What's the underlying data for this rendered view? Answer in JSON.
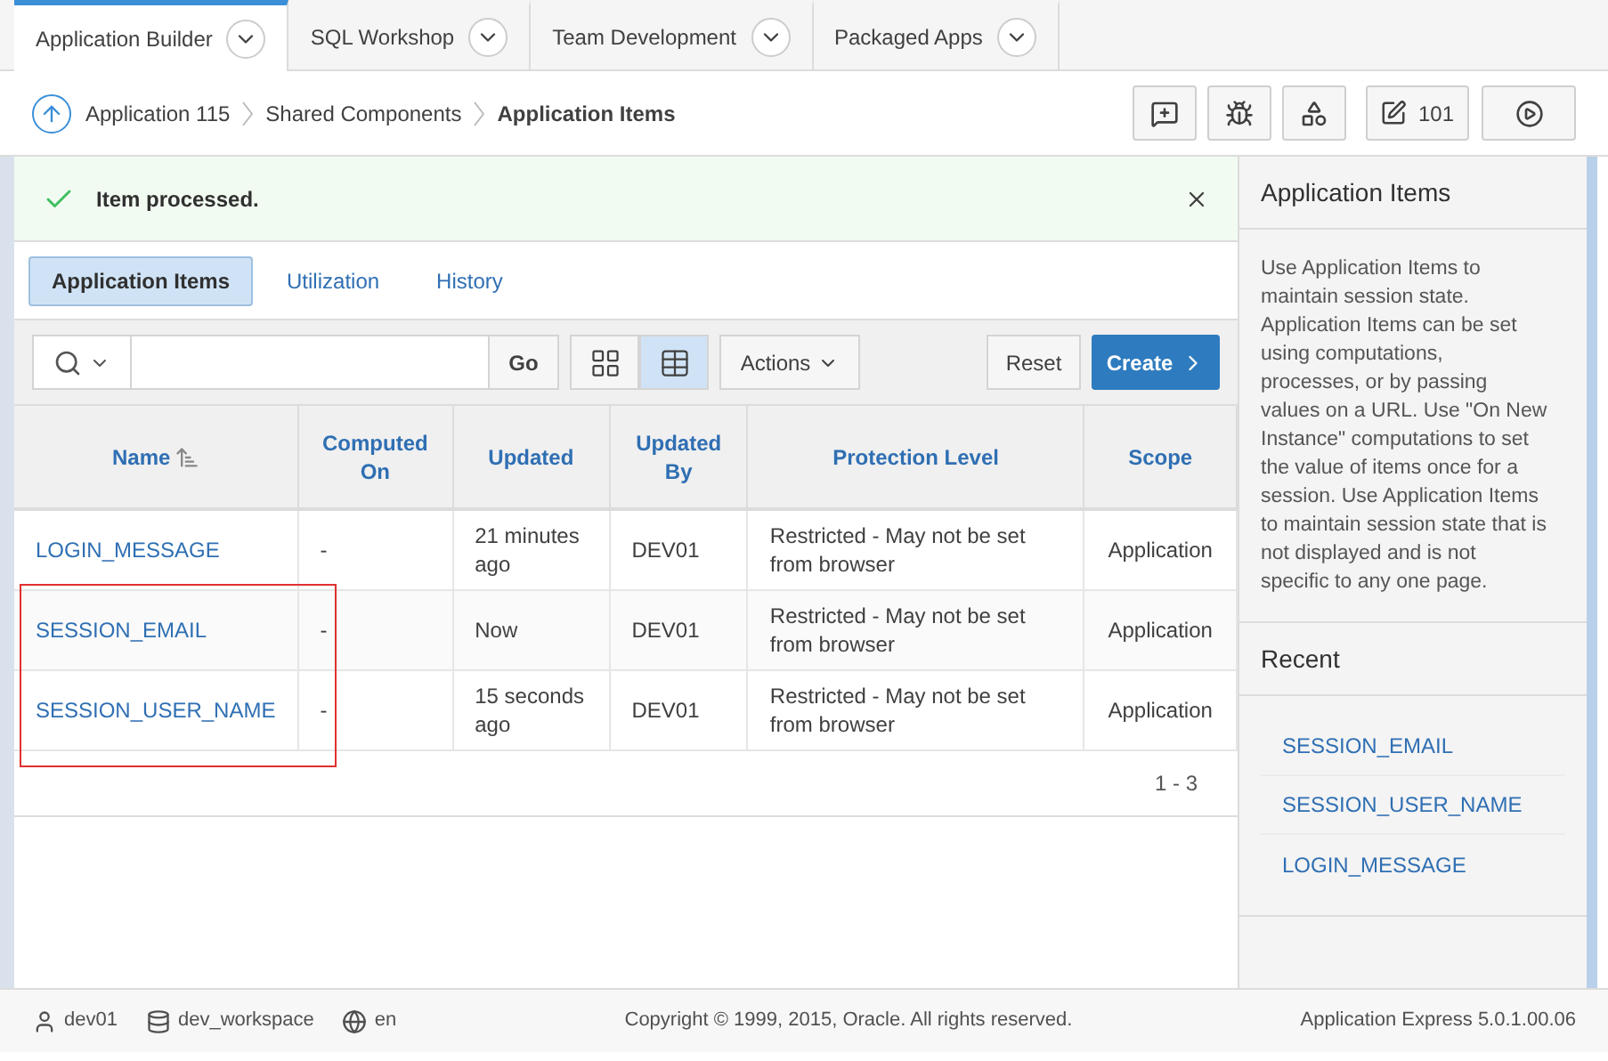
{
  "top_tabs": [
    {
      "label": "Application Builder",
      "selected": true
    },
    {
      "label": "SQL Workshop",
      "selected": false
    },
    {
      "label": "Team Development",
      "selected": false
    },
    {
      "label": "Packaged Apps",
      "selected": false
    }
  ],
  "breadcrumbs": [
    {
      "label": "Application 115",
      "current": false
    },
    {
      "label": "Shared Components",
      "current": false
    },
    {
      "label": "Application Items",
      "current": true
    }
  ],
  "toolbar": [
    {
      "kind": "comment"
    },
    {
      "kind": "bug"
    },
    {
      "kind": "shapes"
    },
    {
      "kind": "edit",
      "label": "101"
    },
    {
      "kind": "run"
    }
  ],
  "alert": {
    "message": "Item processed."
  },
  "sub_tabs": [
    {
      "label": "Application Items",
      "selected": true
    },
    {
      "label": "Utilization",
      "selected": false
    },
    {
      "label": "History",
      "selected": false
    }
  ],
  "report_toolbar": {
    "go": "Go",
    "view_modes": [
      {
        "kind": "icons",
        "selected": false
      },
      {
        "kind": "report",
        "selected": true
      }
    ],
    "actions": "Actions",
    "reset": "Reset",
    "create": "Create"
  },
  "table": {
    "columns": [
      {
        "label": "Name",
        "sorted": true
      },
      {
        "label": "Computed On",
        "sorted": false
      },
      {
        "label": "Updated",
        "sorted": false
      },
      {
        "label": "Updated By",
        "sorted": false
      },
      {
        "label": "Protection Level",
        "sorted": false
      },
      {
        "label": "Scope",
        "sorted": false
      }
    ],
    "rows": [
      {
        "cells": [
          "LOGIN_MESSAGE",
          "-",
          "21 minutes ago",
          "DEV01",
          "Restricted - May not be set from browser",
          "Application"
        ]
      },
      {
        "cells": [
          "SESSION_EMAIL",
          "-",
          "Now",
          "DEV01",
          "Restricted - May not be set from browser",
          "Application"
        ]
      },
      {
        "cells": [
          "SESSION_USER_NAME",
          "-",
          "15 seconds ago",
          "DEV01",
          "Restricted - May not be set from browser",
          "Application"
        ]
      }
    ],
    "pagination": "1 - 3"
  },
  "sidebar": {
    "title": "Application Items",
    "description": "Use Application Items to maintain session state. Application Items can be set using computations, processes, or by passing values on a URL. Use \"On New Instance\" computations to set the value of items once for a session. Use Application Items to maintain session state that is not displayed and is not specific to any one page.",
    "recent_title": "Recent",
    "recent": [
      "SESSION_EMAIL",
      "SESSION_USER_NAME",
      "LOGIN_MESSAGE"
    ]
  },
  "footer": {
    "user": "dev01",
    "workspace": "dev_workspace",
    "language": "en",
    "copyright": "Copyright © 1999, 2015, Oracle. All rights reserved.",
    "version": "Application Express 5.0.1.00.06"
  }
}
